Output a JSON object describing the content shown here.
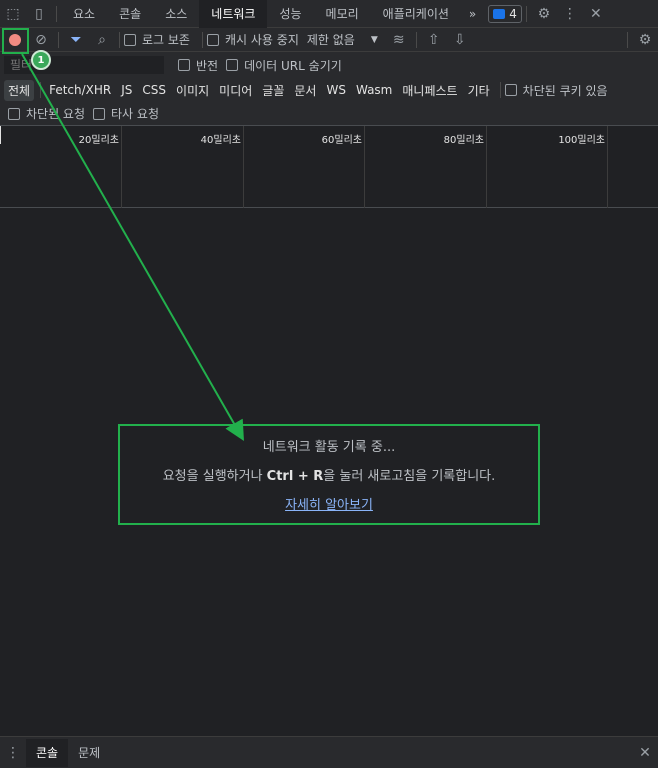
{
  "tabs": [
    "요소",
    "콘솔",
    "소스",
    "네트워크",
    "성능",
    "메모리",
    "애플리케이션"
  ],
  "more_tabs": "»",
  "issues_count": "4",
  "toolbar": {
    "preserve_log": "로그 보존",
    "disable_cache": "캐시 사용 중지",
    "throttle": "제한 없음"
  },
  "filter": {
    "placeholder": "필터",
    "invert": "반전",
    "hide_data_urls": "데이터 URL 숨기기"
  },
  "types": [
    "전체",
    "Fetch/XHR",
    "JS",
    "CSS",
    "이미지",
    "미디어",
    "글꼴",
    "문서",
    "WS",
    "Wasm",
    "매니페스트",
    "기타"
  ],
  "blocked_cookies": "차단된 쿠키 있음",
  "blocked_requests": "차단된 요청",
  "third_party": "타사 요청",
  "timeline_ticks": [
    "20밀리초",
    "40밀리초",
    "60밀리초",
    "80밀리초",
    "100밀리초"
  ],
  "empty": {
    "line1": "네트워크 활동 기록 중...",
    "line2_pre": "요청을 실행하거나 ",
    "key1": "Ctrl",
    "plus": " + ",
    "key2": "R",
    "line2_post": "을 눌러 새로고침을 기록합니다.",
    "learn_more": "자세히 알아보기"
  },
  "drawer": {
    "console": "콘솔",
    "issues": "문제"
  },
  "annotation": {
    "step": "1",
    "color": "#22b04c"
  },
  "colors": {
    "record": "#f28b82",
    "accent": "#8ab4f8",
    "issue_badge": "#1a73e8"
  }
}
